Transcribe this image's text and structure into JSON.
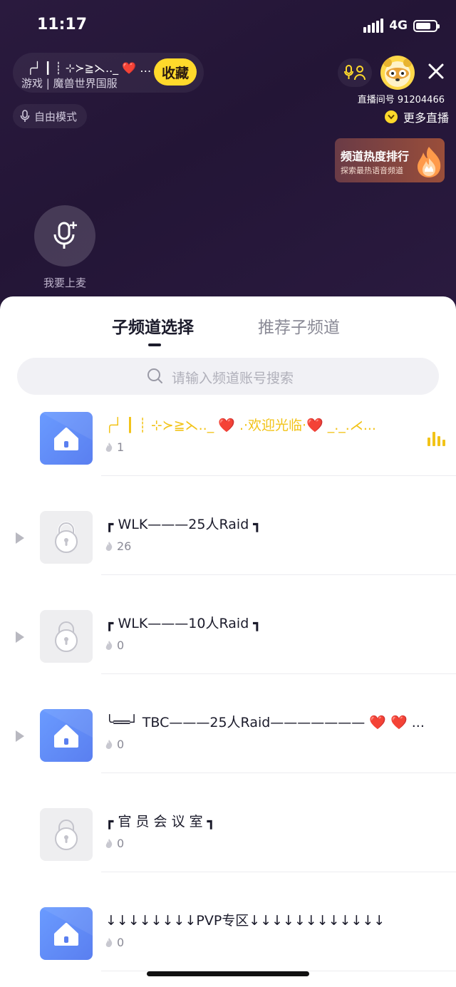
{
  "status_bar": {
    "time": "11:17",
    "network": "4G"
  },
  "room": {
    "name": "╭┘ ┃ ┊ ⊹≻≧⋋.._ ❤️ .·欢迎光临·❤️ _._.⋌...",
    "category": "游戏 | 魔兽世界国服",
    "favorite_label": "收藏",
    "mic_mode_label": "自由模式",
    "room_id_text": "直播间号 91204466",
    "more_live_label": "更多直播"
  },
  "rank_card": {
    "title": "频道热度排行",
    "subtitle": "探索最热语音频道"
  },
  "mic_seat": {
    "label": "我要上麦"
  },
  "sheet": {
    "tabs": [
      {
        "label": "子频道选择",
        "active": true
      },
      {
        "label": "推荐子频道",
        "active": false
      }
    ],
    "search_placeholder": "请输入频道账号搜索",
    "channels": [
      {
        "title": "╭┘ ┃ ┊ ⊹≻≧⋋.._ ❤️ .·欢迎光临·❤️ _._.⋌...",
        "count": "1",
        "icon": "house-icon",
        "locked": false,
        "expandable": false,
        "active": true
      },
      {
        "title": "┏ WLK———25人Raid ┓",
        "count": "26",
        "icon": "lock-icon",
        "locked": true,
        "expandable": true,
        "active": false
      },
      {
        "title": "┏ WLK———10人Raid ┓",
        "count": "0",
        "icon": "lock-icon",
        "locked": true,
        "expandable": true,
        "active": false
      },
      {
        "title": "╰══┘ TBC———25人Raid——————— ❤️ ❤️ ...",
        "count": "0",
        "icon": "house-icon",
        "locked": false,
        "expandable": true,
        "active": false
      },
      {
        "title": "┏ 官 员 会 议 室 ┓",
        "count": "0",
        "icon": "lock-icon",
        "locked": true,
        "expandable": false,
        "active": false
      },
      {
        "title": "↓↓↓↓↓↓↓↓PVP专区↓↓↓↓↓↓↓↓↓↓↓↓",
        "count": "0",
        "icon": "house-icon",
        "locked": false,
        "expandable": false,
        "active": false
      }
    ]
  }
}
